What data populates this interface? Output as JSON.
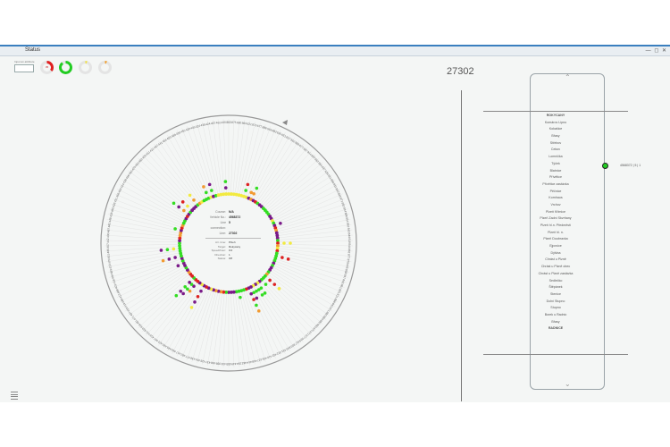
{
  "window": {
    "title": "Status",
    "controls": "— ◻ ✕"
  },
  "query": {
    "label": "Input an attribute",
    "value": ""
  },
  "gauges": [
    {
      "name": "gauge-red",
      "value": 0.35,
      "color": "#e02020",
      "text": "35"
    },
    {
      "name": "gauge-green",
      "value": 0.9,
      "color": "#22cc22",
      "text": ""
    },
    {
      "name": "gauge-yellow",
      "value": 0.05,
      "color": "#f0e050",
      "text": ""
    },
    {
      "name": "gauge-orange",
      "value": 0.05,
      "color": "#f0a030",
      "text": ""
    }
  ],
  "count": "27302",
  "info": {
    "rows": [
      {
        "k": "Course:",
        "v": "N/A"
      },
      {
        "k": "Vehicle No.:",
        "v": "4568372"
      },
      {
        "k": "Line connection:",
        "v": "5"
      },
      {
        "k": "Line:",
        "v": "27302"
      }
    ],
    "small_rows": [
      {
        "k": "Arr. time:",
        "v": "Plzeň"
      },
      {
        "k": "Target:",
        "v": "Rokycany"
      },
      {
        "k": "Speed/hour:",
        "v": "0.0"
      },
      {
        "k": "Direction:",
        "v": "1"
      },
      {
        "k": "Status:",
        "v": "Off"
      }
    ]
  },
  "stops": [
    {
      "label": "ROKYCANY",
      "bold": true
    },
    {
      "label": "Komárov Lipno"
    },
    {
      "label": "Kokašice"
    },
    {
      "label": "Břasy"
    },
    {
      "label": "Střebov"
    },
    {
      "label": "Cekov"
    },
    {
      "label": "Lomnička"
    },
    {
      "label": "Týček"
    },
    {
      "label": "Blatnice"
    },
    {
      "label": "Přívětice"
    },
    {
      "label": "Přívětice zastávka"
    },
    {
      "label": "Pěčnice"
    },
    {
      "label": "Kornhaus"
    },
    {
      "label": "Vrchov"
    },
    {
      "label": "Plzeň Křimice"
    },
    {
      "label": "Plzeň Zadní Skvrňany"
    },
    {
      "label": "Plzeň hl.n. Předměstí"
    },
    {
      "label": "Plzeň hl. n."
    },
    {
      "label": "Plzeň Doubravka"
    },
    {
      "label": "Ejpovice"
    },
    {
      "label": "Dýšina"
    },
    {
      "label": "Chrást u Plzně"
    },
    {
      "label": "Chrást u Plzně obec"
    },
    {
      "label": "Chrást u Plzně zastávka"
    },
    {
      "label": "Sedlečko"
    },
    {
      "label": "Štěpánek"
    },
    {
      "label": "Stenice"
    },
    {
      "label": "Dolní Stupno"
    },
    {
      "label": "Stupno"
    },
    {
      "label": "Borek u Radnic"
    },
    {
      "label": "Břasy"
    },
    {
      "label": "RADNICE",
      "bold": true
    }
  ],
  "vehicle": {
    "label": "4568372 | 5 | 1",
    "color": "#22cc22"
  },
  "ring_labels": [
    "863",
    "875",
    "680",
    "863",
    "621",
    "876",
    "677",
    "886",
    "669",
    "883",
    "630",
    "651",
    "657",
    "862",
    "888",
    "677",
    "687",
    "844",
    "847",
    "862",
    "864",
    "637",
    "626",
    "621",
    "896",
    "851",
    "843",
    "845",
    "871",
    "852",
    "814",
    "896",
    "851",
    "862",
    "843",
    "844",
    "819",
    "844",
    "862",
    "877",
    "879",
    "645",
    "658",
    "847",
    "842",
    "861",
    "801",
    "811",
    "898",
    "842",
    "671",
    "860",
    "884",
    "882",
    "883",
    "875",
    "871",
    "877",
    "828",
    "817",
    "803",
    "843",
    "431",
    "422",
    "442",
    "416",
    "426",
    "437",
    "448",
    "414",
    "442",
    "394",
    "449",
    "459",
    "430",
    "399",
    "448",
    "437",
    "428",
    "454",
    "438",
    "477",
    "462",
    "417",
    "466",
    "445",
    "460",
    "422",
    "447",
    "418",
    "441",
    "432",
    "456",
    "481",
    "471",
    "437",
    "433",
    "419",
    "486",
    "413",
    "486",
    "402",
    "418",
    "434",
    "483",
    "418",
    "470",
    "451",
    "486",
    "407",
    "442",
    "430",
    "487",
    "442",
    "449",
    "428",
    "490",
    "426",
    "431",
    "456",
    "464",
    "424",
    "428",
    "406",
    "483",
    "429",
    "483",
    "482",
    "403",
    "451",
    "421",
    "467",
    "441",
    "456",
    "403",
    "489",
    "439",
    "450",
    "420",
    "449",
    "424",
    "435",
    "424",
    "467",
    "462",
    "430"
  ],
  "palette": {
    "green": "#33dd22",
    "purple": "#7a1a88",
    "red": "#dd2222",
    "yellow": "#f2ea40",
    "orange": "#f29a30",
    "ring": "#999999"
  }
}
